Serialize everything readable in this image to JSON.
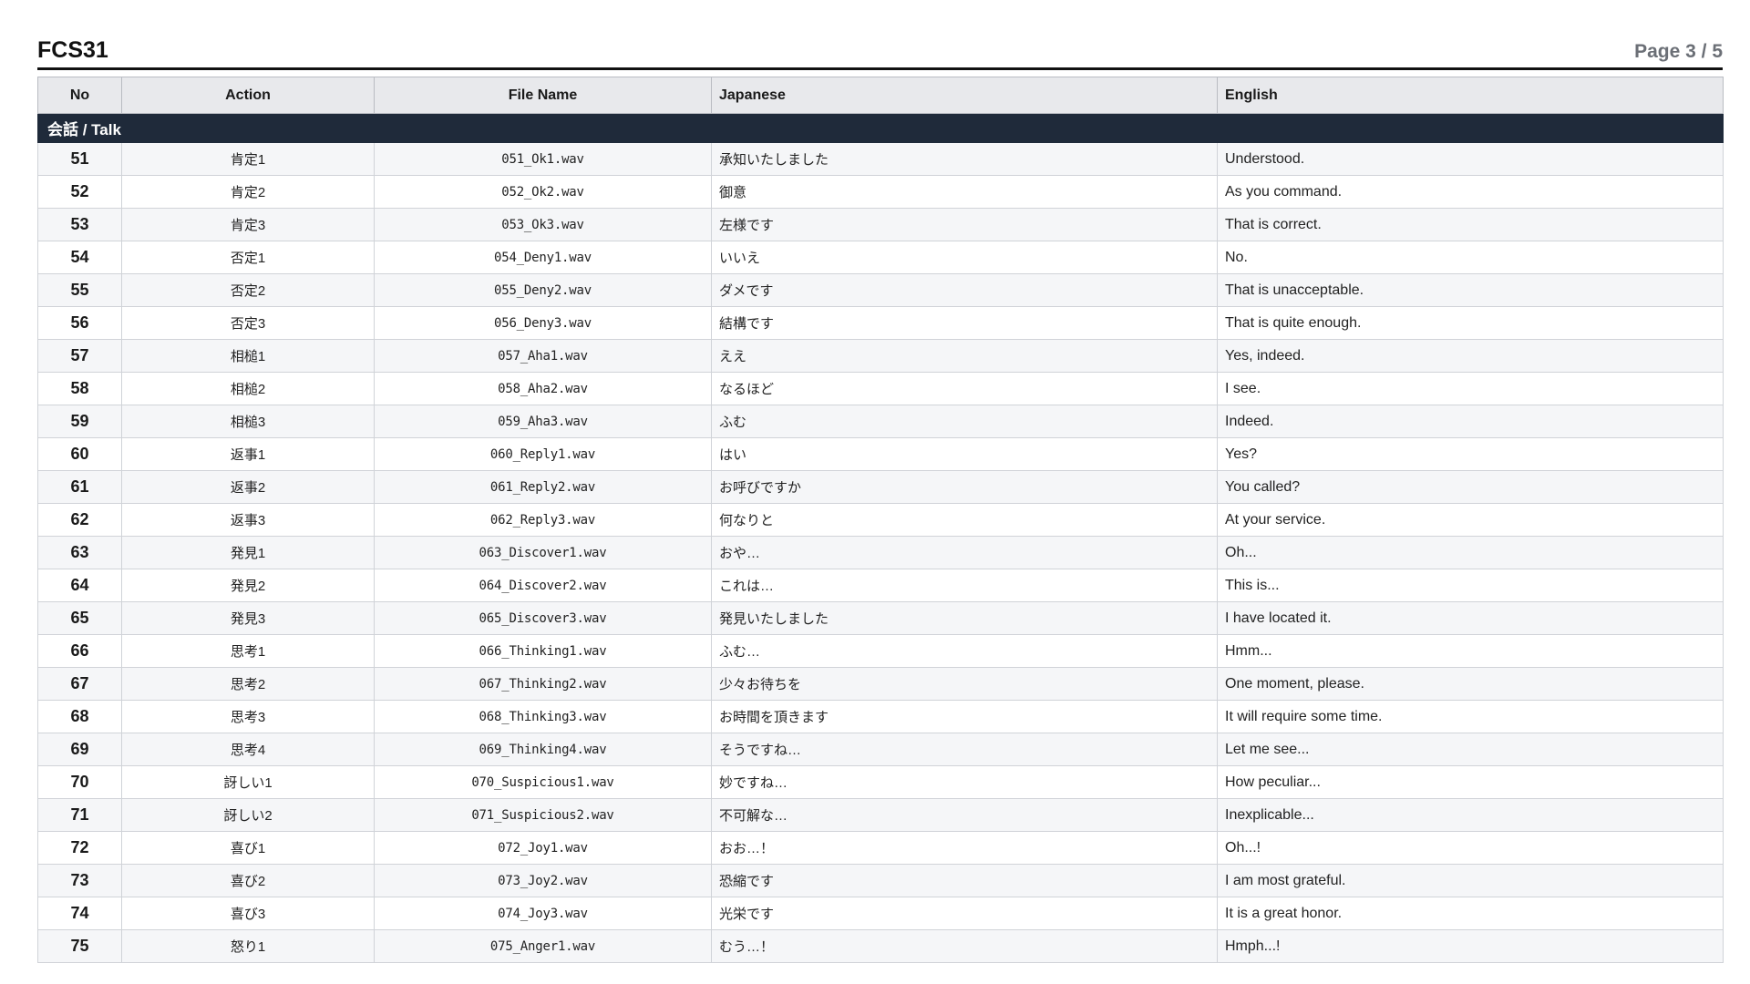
{
  "header": {
    "title": "FCS31",
    "page_indicator": "Page 3 / 5"
  },
  "table": {
    "columns": {
      "no": "No",
      "action": "Action",
      "file_name": "File Name",
      "japanese": "Japanese",
      "english": "English"
    },
    "section_label": "会話 / Talk",
    "rows": [
      {
        "no": "51",
        "action": "肯定1",
        "file": "051_Ok1.wav",
        "japanese": "承知いたしました",
        "english": "Understood."
      },
      {
        "no": "52",
        "action": "肯定2",
        "file": "052_Ok2.wav",
        "japanese": "御意",
        "english": "As you command."
      },
      {
        "no": "53",
        "action": "肯定3",
        "file": "053_Ok3.wav",
        "japanese": "左様です",
        "english": "That is correct."
      },
      {
        "no": "54",
        "action": "否定1",
        "file": "054_Deny1.wav",
        "japanese": "いいえ",
        "english": "No."
      },
      {
        "no": "55",
        "action": "否定2",
        "file": "055_Deny2.wav",
        "japanese": "ダメです",
        "english": "That is unacceptable."
      },
      {
        "no": "56",
        "action": "否定3",
        "file": "056_Deny3.wav",
        "japanese": "結構です",
        "english": "That is quite enough."
      },
      {
        "no": "57",
        "action": "相槌1",
        "file": "057_Aha1.wav",
        "japanese": "ええ",
        "english": "Yes, indeed."
      },
      {
        "no": "58",
        "action": "相槌2",
        "file": "058_Aha2.wav",
        "japanese": "なるほど",
        "english": "I see."
      },
      {
        "no": "59",
        "action": "相槌3",
        "file": "059_Aha3.wav",
        "japanese": "ふむ",
        "english": "Indeed."
      },
      {
        "no": "60",
        "action": "返事1",
        "file": "060_Reply1.wav",
        "japanese": "はい",
        "english": "Yes?"
      },
      {
        "no": "61",
        "action": "返事2",
        "file": "061_Reply2.wav",
        "japanese": "お呼びですか",
        "english": "You called?"
      },
      {
        "no": "62",
        "action": "返事3",
        "file": "062_Reply3.wav",
        "japanese": "何なりと",
        "english": "At your service."
      },
      {
        "no": "63",
        "action": "発見1",
        "file": "063_Discover1.wav",
        "japanese": "おや…",
        "english": "Oh..."
      },
      {
        "no": "64",
        "action": "発見2",
        "file": "064_Discover2.wav",
        "japanese": "これは…",
        "english": "This is..."
      },
      {
        "no": "65",
        "action": "発見3",
        "file": "065_Discover3.wav",
        "japanese": "発見いたしました",
        "english": "I have located it."
      },
      {
        "no": "66",
        "action": "思考1",
        "file": "066_Thinking1.wav",
        "japanese": "ふむ…",
        "english": "Hmm..."
      },
      {
        "no": "67",
        "action": "思考2",
        "file": "067_Thinking2.wav",
        "japanese": "少々お待ちを",
        "english": "One moment, please."
      },
      {
        "no": "68",
        "action": "思考3",
        "file": "068_Thinking3.wav",
        "japanese": "お時間を頂きます",
        "english": "It will require some time."
      },
      {
        "no": "69",
        "action": "思考4",
        "file": "069_Thinking4.wav",
        "japanese": "そうですね…",
        "english": "Let me see..."
      },
      {
        "no": "70",
        "action": "訝しい1",
        "file": "070_Suspicious1.wav",
        "japanese": "妙ですね…",
        "english": "How peculiar..."
      },
      {
        "no": "71",
        "action": "訝しい2",
        "file": "071_Suspicious2.wav",
        "japanese": "不可解な…",
        "english": "Inexplicable..."
      },
      {
        "no": "72",
        "action": "喜び1",
        "file": "072_Joy1.wav",
        "japanese": "おお…！",
        "english": "Oh...!"
      },
      {
        "no": "73",
        "action": "喜び2",
        "file": "073_Joy2.wav",
        "japanese": "恐縮です",
        "english": "I am most grateful."
      },
      {
        "no": "74",
        "action": "喜び3",
        "file": "074_Joy3.wav",
        "japanese": "光栄です",
        "english": "It is a great honor."
      },
      {
        "no": "75",
        "action": "怒り1",
        "file": "075_Anger1.wav",
        "japanese": "むう…！",
        "english": "Hmph...!"
      }
    ]
  }
}
